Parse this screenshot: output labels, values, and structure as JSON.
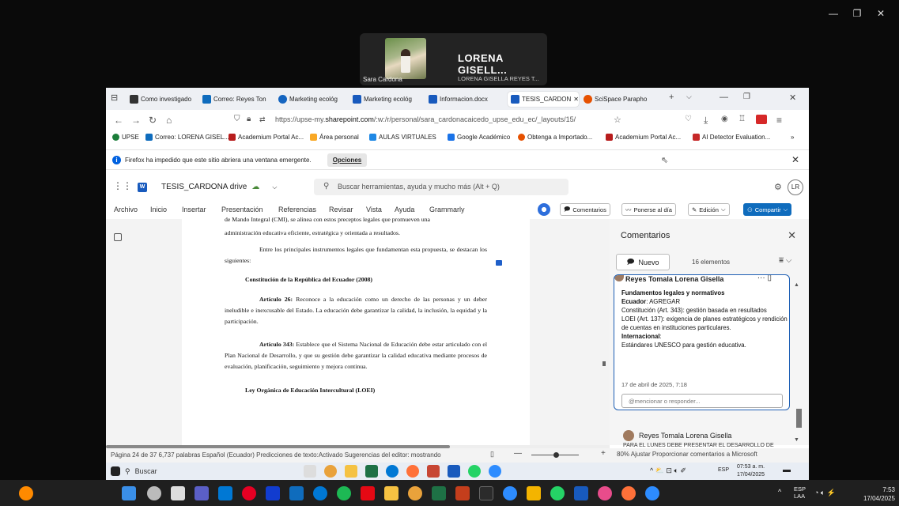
{
  "meeting": {
    "tile_small_name": "Sara Cardona",
    "tile_name": "LORENA GISELL...",
    "tile_full_name": "LORENA GISELLA REYES T..."
  },
  "tabs": [
    {
      "label": "Como investigado",
      "color": "#333"
    },
    {
      "label": "Correo: Reyes Ton",
      "color": "#0f6cbd"
    },
    {
      "label": "Marketing ecológ",
      "color": "#1565c0"
    },
    {
      "label": "Marketing ecológ",
      "color": "#185abd"
    },
    {
      "label": "Informacion.docx",
      "color": "#185abd"
    },
    {
      "label": "TESIS_CARDON",
      "color": "#185abd"
    },
    {
      "label": "SciSpace Parapho",
      "color": "#e65100"
    }
  ],
  "address": {
    "url_prefix": "https://upse-my.",
    "url_domain": "sharepoint.com",
    "url_rest": "/:w:/r/personal/sara_cardonacaicedo_upse_edu_ec/_layouts/15/"
  },
  "bookmarks": [
    {
      "label": "UPSE",
      "color": "#1b7d3a"
    },
    {
      "label": "Correo: LORENA GISEL...",
      "color": "#0f6cbd"
    },
    {
      "label": "Academium Portal Ac...",
      "color": "#b71c1c"
    },
    {
      "label": "Área personal",
      "color": "#f9a825"
    },
    {
      "label": "AULAS VIRTUALES",
      "color": "#1e88e5"
    },
    {
      "label": "Google Académico",
      "color": "#1a73e8"
    },
    {
      "label": "Obtenga a Importado...",
      "color": "#e65100"
    },
    {
      "label": "Academium Portal Ac...",
      "color": "#b71c1c"
    },
    {
      "label": "AI Detector Evaluation...",
      "color": "#c62828"
    }
  ],
  "popup": {
    "text": "Firefox ha impedido que este sitio abriera una ventana emergente.",
    "options": "Opciones"
  },
  "word": {
    "doc_title": "TESIS_CARDONA drive",
    "search_placeholder": "Buscar herramientas, ayuda y mucho más (Alt + Q)",
    "avatar": "LR",
    "menus": [
      "Archivo",
      "Inicio",
      "Insertar",
      "Presentación",
      "Referencias",
      "Revisar",
      "Vista",
      "Ayuda",
      "Grammarly"
    ],
    "btn_comments": "Comentarios",
    "btn_catchup": "Ponerse al día",
    "btn_edit": "Edición",
    "btn_share": "Compartir"
  },
  "document": {
    "p0": "de Mando Integral (CMI), se alinea con estos preceptos legales que promueven una",
    "p0b": "administración educativa eficiente, estratégica y orientada a resultados.",
    "p1": "Entre los principales instrumentos legales que fundamentan esta propuesta, se destacan los siguientes:",
    "h1": "Constitución de la República del Ecuador (2008)",
    "a26_title": "Artículo 26:",
    "a26": "Reconoce a la educación como un derecho de las personas y un deber ineludible e inexcusable del Estado. La educación debe garantizar la calidad, la inclusión, la equidad y la participación.",
    "a343_title": "Artículo 343:",
    "a343": "Establece que el Sistema Nacional de Educación debe estar articulado con el Plan Nacional de Desarrollo, y que su gestión debe garantizar la calidad educativa mediante procesos de evaluación, planificación, seguimiento y mejora continua.",
    "h2": "Ley Orgánica de Educación Intercultural (LOEI)"
  },
  "comments": {
    "title": "Comentarios",
    "new_btn": "Nuevo",
    "count": "16 elementos",
    "card_author": "Reyes Tomala Lorena Gisella",
    "card_l1": "Fundamentos legales y normativos",
    "card_l2_label": "Ecuador",
    "card_l2": ": AGREGAR",
    "card_l3": "Constitución (Art. 343): gestión basada en resultados",
    "card_l4": "LOEI (Art. 137): exigencia de planes estratégicos y rendición de cuentas en instituciones particulares.",
    "card_l5": "Internacional",
    "card_l5b": ":",
    "card_l6": "Estándares UNESCO para gestión educativa.",
    "card_date": "17 de abril de 2025, 7:18",
    "reply_placeholder": "@mencionar o responder...",
    "card2_author": "Reyes Tomala Lorena Gisella",
    "card2_preview": "PARA EL LUNES DEBE PRESENTAR EL DESARROLLO DE"
  },
  "status": {
    "left": "Página 24 de 37   6,737 palabras   Español (Ecuador)   Predicciones de texto:Activado   Sugerencias del editor: mostrando",
    "zoom": "80%   Ajustar   Proporcionar comentarios a Microsoft"
  },
  "inner_taskbar": {
    "search": "Buscar",
    "lang": "ESP",
    "time": "07:53 a. m.",
    "date": "17/04/2025"
  },
  "outer_taskbar": {
    "lang1": "ESP",
    "lang2": "LAA",
    "time": "7:53",
    "date": "17/04/2025"
  }
}
